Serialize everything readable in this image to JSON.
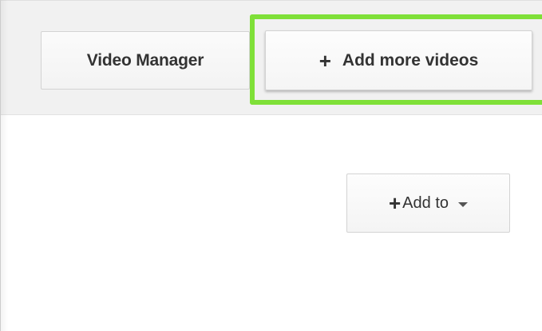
{
  "header": {
    "video_manager_label": "Video Manager",
    "add_more_videos_label": "Add more videos",
    "add_more_icon": "plus-icon",
    "highlight_color": "#7fe038"
  },
  "content": {
    "add_to_label": "Add to",
    "add_to_icon": "plus-icon",
    "add_to_dropdown_icon": "caret-down-icon"
  }
}
